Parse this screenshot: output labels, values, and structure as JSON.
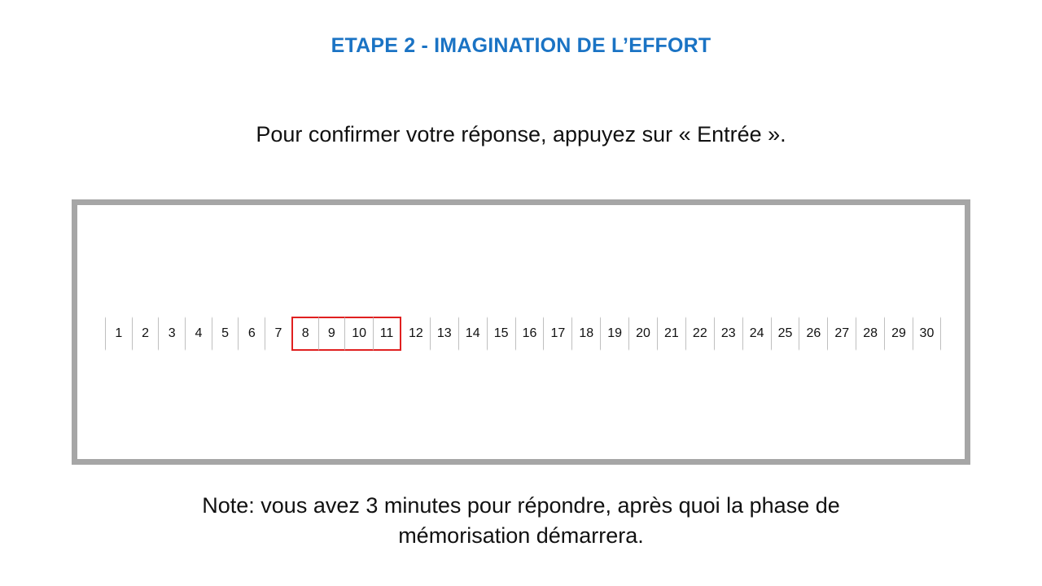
{
  "title": "ETAPE 2 - IMAGINATION DE L’EFFORT",
  "instruction": "Pour confirmer votre réponse, appuyez sur « Entrée ».",
  "scale": {
    "values": [
      "1",
      "2",
      "3",
      "4",
      "5",
      "6",
      "7",
      "8",
      "9",
      "10",
      "11",
      "12",
      "13",
      "14",
      "15",
      "16",
      "17",
      "18",
      "19",
      "20",
      "21",
      "22",
      "23",
      "24",
      "25",
      "26",
      "27",
      "28",
      "29",
      "30"
    ],
    "selected_range": [
      8,
      11
    ],
    "selection_color": "#e02020"
  },
  "note": {
    "line1": "Note: vous avez 3 minutes pour répondre, après quoi la phase de",
    "line2": "mémorisation démarrera."
  },
  "colors": {
    "title": "#1a73c4",
    "frame_border": "#a6a6a6"
  }
}
